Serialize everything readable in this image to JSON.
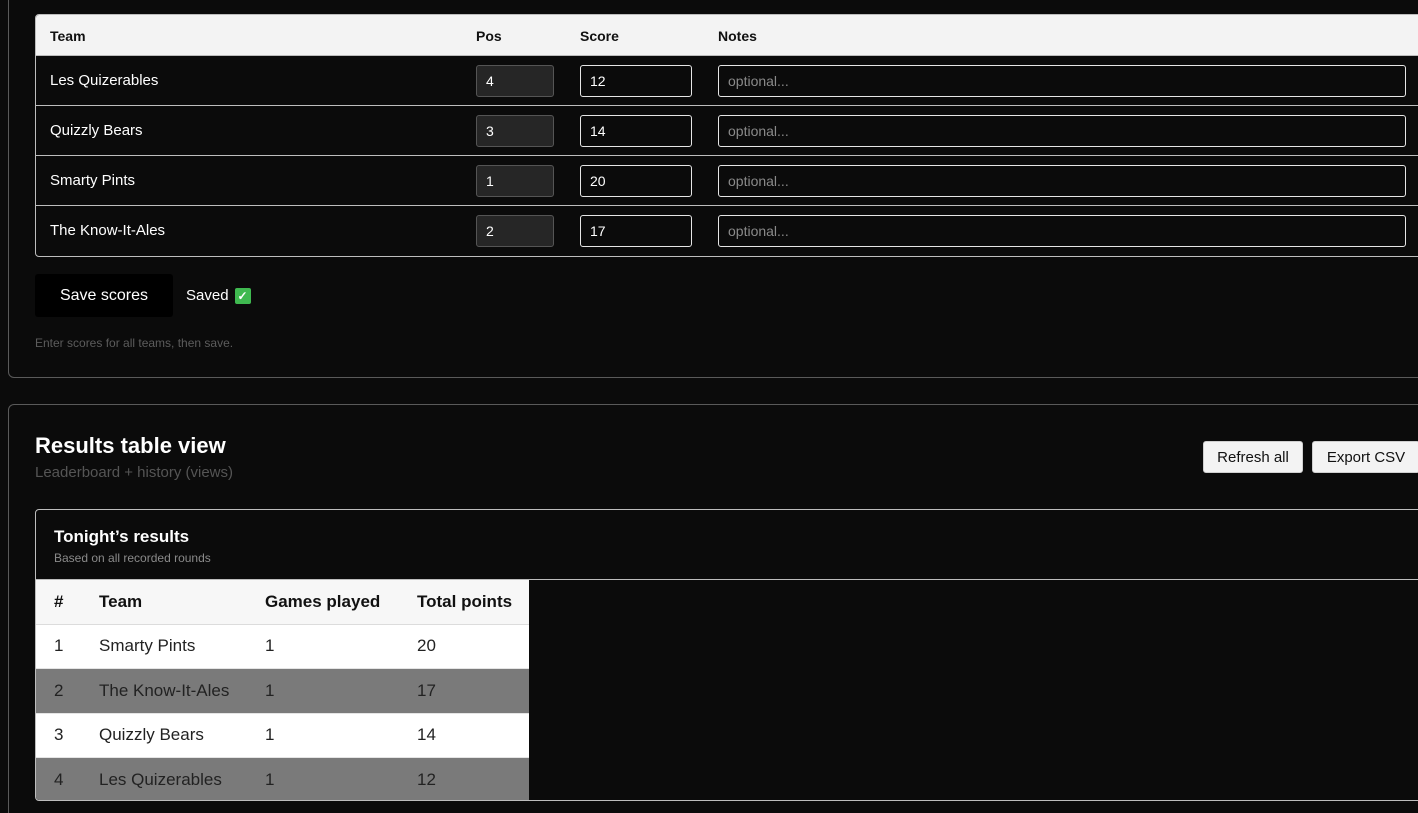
{
  "entry": {
    "headers": {
      "team": "Team",
      "pos": "Pos",
      "score": "Score",
      "notes": "Notes"
    },
    "notes_placeholder": "optional...",
    "rows": [
      {
        "team": "Les Quizerables",
        "pos": "4",
        "score": "12"
      },
      {
        "team": "Quizzly Bears",
        "pos": "3",
        "score": "14"
      },
      {
        "team": "Smarty Pints",
        "pos": "1",
        "score": "20"
      },
      {
        "team": "The Know-It-Ales",
        "pos": "2",
        "score": "17"
      }
    ],
    "save_label": "Save scores",
    "saved_label": "Saved",
    "saved_icon": "check-icon",
    "hint": "Enter scores for all teams, then save."
  },
  "results": {
    "title": "Results table view",
    "subtitle": "Leaderboard + history (views)",
    "refresh_label": "Refresh all",
    "export_label": "Export CSV",
    "tonight": {
      "title": "Tonight’s results",
      "subtitle": "Based on all recorded rounds",
      "headers": {
        "rank": "#",
        "team": "Team",
        "games": "Games played",
        "points": "Total points"
      },
      "rows": [
        {
          "rank": "1",
          "team": "Smarty Pints",
          "games": "1",
          "points": "20"
        },
        {
          "rank": "2",
          "team": "The Know-It-Ales",
          "games": "1",
          "points": "17"
        },
        {
          "rank": "3",
          "team": "Quizzly Bears",
          "games": "1",
          "points": "14"
        },
        {
          "rank": "4",
          "team": "Les Quizerables",
          "games": "1",
          "points": "12"
        }
      ]
    }
  },
  "colors": {
    "background": "#0b0b0b",
    "saved_check": "#3fb950",
    "row_alt": "#7a7a7a"
  }
}
